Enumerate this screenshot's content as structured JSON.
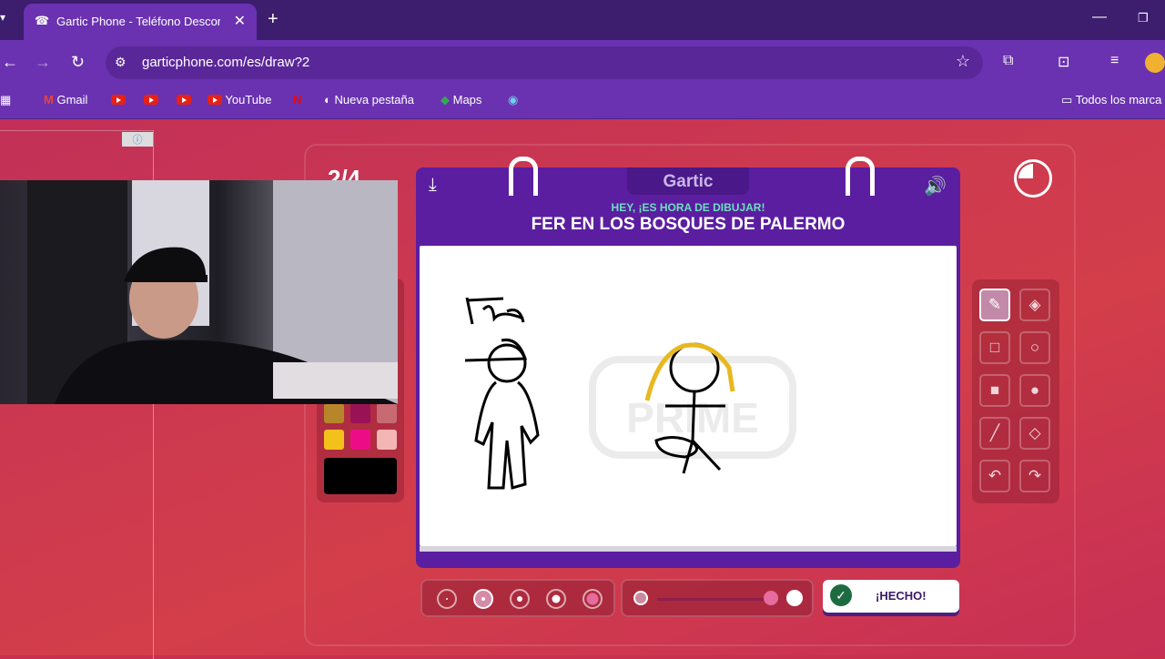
{
  "browser": {
    "tab_title": "Gartic Phone - Teléfono Descon",
    "url": "garticphone.com/es/draw?2",
    "bookmarks": {
      "gmail": "Gmail",
      "youtube": "YouTube",
      "new_tab": "Nueva pestaña",
      "maps": "Maps",
      "all_bookmarks": "Todos los marca"
    }
  },
  "page": {
    "ad_info": "ⓘ",
    "turn": "2/4",
    "logo": "Gartic",
    "subtitle": "HEY, ¡ES HORA DE DIBUJAR!",
    "prompt": "FER EN LOS BOSQUES DE PALERMO",
    "done_label": "¡HECHO!",
    "canvas_watermark": "PRIME"
  },
  "palette": {
    "colors": [
      "#b8862a",
      "#9a1256",
      "#c86a72",
      "#f3c11b",
      "#ec0d86",
      "#f4b5b5"
    ],
    "selected_color": "#000000"
  },
  "tools": [
    "pencil-icon",
    "eraser-icon",
    "rect-outline-icon",
    "ellipse-outline-icon",
    "rect-fill-icon",
    "ellipse-fill-icon",
    "line-icon",
    "bucket-icon",
    "undo-icon",
    "redo-icon"
  ],
  "brush_sizes": {
    "count": 5,
    "selected_index": 1
  },
  "opacity": {
    "value": 0.9
  },
  "colors": {
    "accent": "#5b1ea0",
    "background": "#c8304e",
    "chrome": "#6a32b0"
  }
}
